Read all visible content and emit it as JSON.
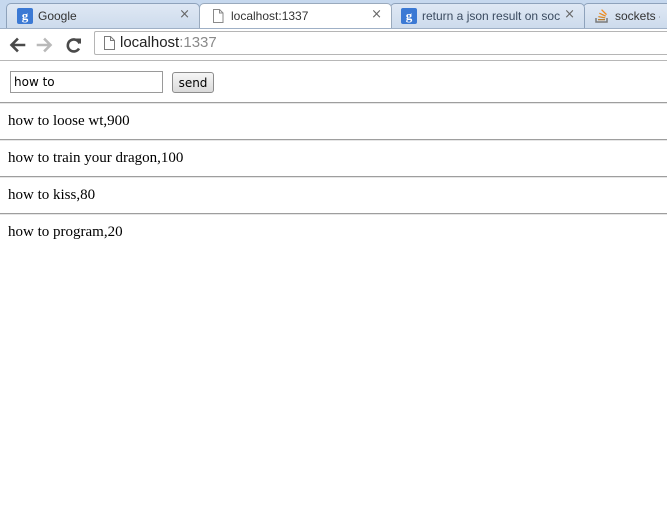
{
  "tabs": [
    {
      "title": "Google",
      "icon": "google-icon",
      "close": "×"
    },
    {
      "title": "localhost:1337",
      "icon": "page-icon",
      "close": "×"
    },
    {
      "title": "return a json result on soc",
      "icon": "google-icon",
      "close": "×"
    },
    {
      "title": "sockets - r",
      "icon": "stackoverflow-icon",
      "close": ""
    }
  ],
  "toolbar": {
    "url_host": "localhost",
    "url_port": ":1337"
  },
  "form": {
    "input_value": "how to",
    "button_label": "send"
  },
  "results": [
    "how to loose wt,900",
    "how to train your dragon,100",
    "how to kiss,80",
    "how to program,20"
  ],
  "colors": {
    "tabstrip": "#c6d8ee",
    "google_blue": "#3b79d4"
  }
}
